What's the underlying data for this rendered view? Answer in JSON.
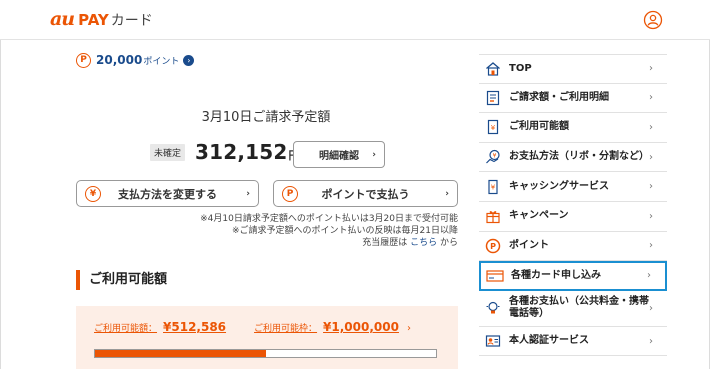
{
  "header": {
    "logo_au": "au",
    "logo_pay": "PAY",
    "logo_card": "カード"
  },
  "points": {
    "badge": "P",
    "value": "20,000",
    "unit": "ポイント"
  },
  "billing": {
    "title": "3月10日ご請求予定額",
    "status_badge": "未確定",
    "amount": "312,152",
    "unit": "円",
    "detail_button": "明細確認"
  },
  "actions": {
    "change_payment": "支払方法を変更する",
    "change_payment_icon": "¥",
    "pay_with_points": "ポイントで支払う",
    "pay_with_points_icon": "P"
  },
  "notes": {
    "line1": "※4月10日請求予定額へのポイント払いは3月20日まで受付可能",
    "line2": "※ご請求予定額へのポイント払いの反映は毎月21日以降",
    "line3_prefix": "充当履歴は",
    "line3_link": "こちら",
    "line3_suffix": "から"
  },
  "available": {
    "heading": "ご利用可能額",
    "label": "ご利用可能額：",
    "value": "¥512,586",
    "limit_label": "ご利用可能枠：",
    "limit_value": "¥1,000,000",
    "usage_fraction": 0.5
  },
  "menu": {
    "items": [
      {
        "label": "TOP",
        "icon": "home-icon"
      },
      {
        "label": "ご請求額・ご利用明細",
        "icon": "statement-icon"
      },
      {
        "label": "ご利用可能額",
        "icon": "available-amount-icon"
      },
      {
        "label": "お支払方法（リボ・分割など）",
        "icon": "payment-method-icon"
      },
      {
        "label": "キャッシングサービス",
        "icon": "cashing-icon"
      },
      {
        "label": "キャンペーン",
        "icon": "gift-icon"
      },
      {
        "label": "ポイント",
        "icon": "point-icon"
      },
      {
        "label": "各種カード申し込み",
        "icon": "card-application-icon"
      },
      {
        "label": "各種お支払い（公共料金・携帯電話等）",
        "icon": "bulb-icon"
      },
      {
        "label": "本人認証サービス",
        "icon": "auth-icon"
      }
    ]
  },
  "colors": {
    "accent": "#eb5505",
    "link": "#1a4b8c",
    "highlight": "#1a8fd1"
  }
}
